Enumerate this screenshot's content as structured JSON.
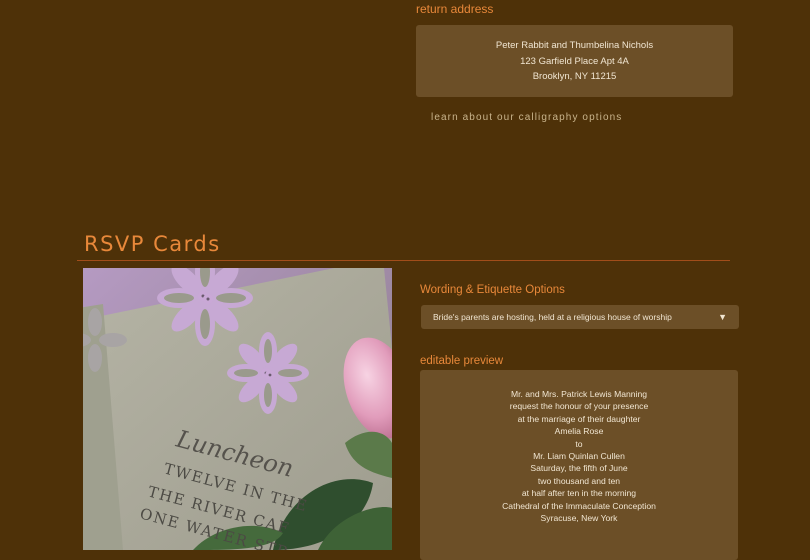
{
  "return_address": {
    "label": "return address",
    "lines": [
      "Peter Rabbit and Thumbelina Nichols",
      "123 Garfield Place Apt 4A",
      "Brooklyn, NY 11215"
    ],
    "calligraphy_link": "learn about our calligraphy options"
  },
  "rsvp": {
    "title": "RSVP Cards",
    "card_text": [
      "Luncheon",
      "TWELVE IN THE",
      "THE RIVER CAF",
      "ONE WATER STR"
    ],
    "wording_label": "Wording & Etiquette Options",
    "wording_selected": "Bride's parents are hosting, held at a religious house of worship",
    "preview_label": "editable preview",
    "preview_lines": [
      "Mr. and Mrs. Patrick Lewis Manning",
      "request the honour of your presence",
      "at the marriage of their daughter",
      "Amelia Rose",
      "to",
      "Mr. Liam Quinlan Cullen",
      "Saturday, the fifth of June",
      "two thousand and ten",
      "at half after ten in the morning",
      "Cathedral of the Immaculate Conception",
      "Syracuse, New York"
    ]
  },
  "colors": {
    "background": "#4e3108",
    "accent": "#e8883a",
    "panel": "#6c4f27",
    "panel_text": "#f1e6d2"
  },
  "icons": {
    "dropdown": "triangle-down-icon"
  }
}
